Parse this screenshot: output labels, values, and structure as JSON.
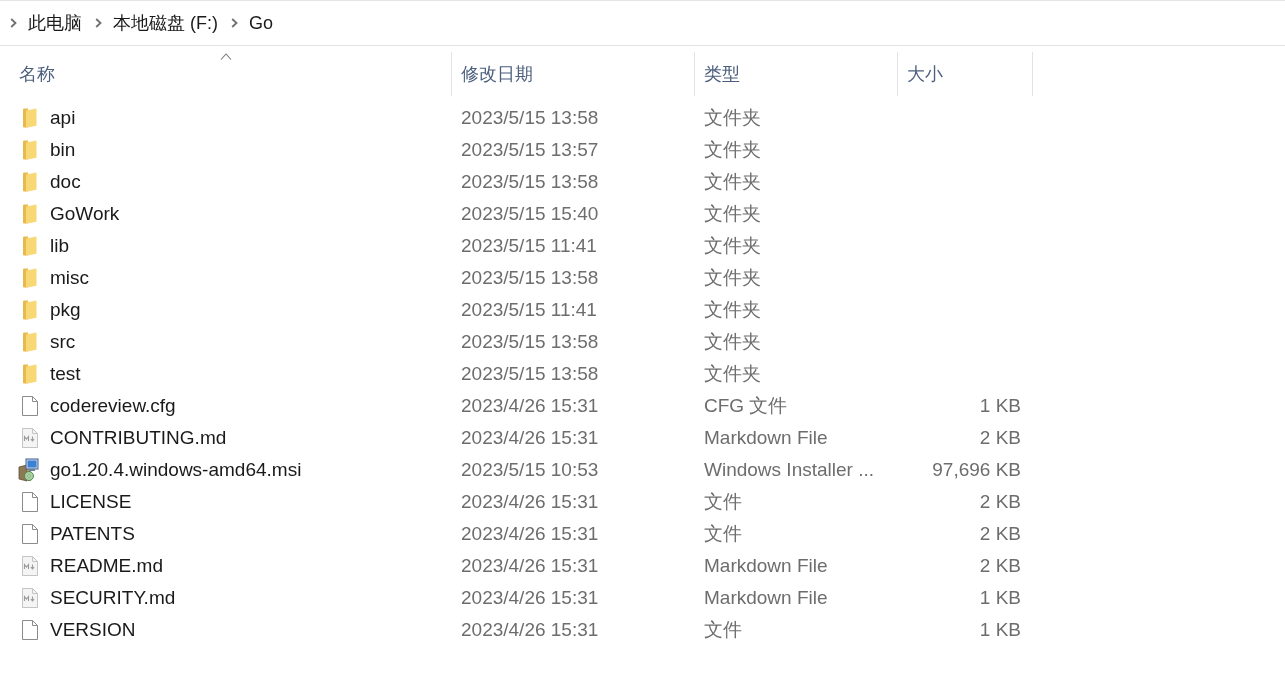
{
  "breadcrumb": [
    "此电脑",
    "本地磁盘 (F:)",
    "Go"
  ],
  "columns": [
    {
      "label": "名称",
      "sorted": true
    },
    {
      "label": "修改日期",
      "sorted": false
    },
    {
      "label": "类型",
      "sorted": false
    },
    {
      "label": "大小",
      "sorted": false
    }
  ],
  "files": [
    {
      "kind": "folder",
      "name": "api",
      "modified": "2023/5/15 13:58",
      "type": "文件夹"
    },
    {
      "kind": "folder",
      "name": "bin",
      "modified": "2023/5/15 13:57",
      "type": "文件夹"
    },
    {
      "kind": "folder",
      "name": "doc",
      "modified": "2023/5/15 13:58",
      "type": "文件夹"
    },
    {
      "kind": "folder",
      "name": "GoWork",
      "modified": "2023/5/15 15:40",
      "type": "文件夹"
    },
    {
      "kind": "folder",
      "name": "lib",
      "modified": "2023/5/15 11:41",
      "type": "文件夹"
    },
    {
      "kind": "folder",
      "name": "misc",
      "modified": "2023/5/15 13:58",
      "type": "文件夹"
    },
    {
      "kind": "folder",
      "name": "pkg",
      "modified": "2023/5/15 11:41",
      "type": "文件夹"
    },
    {
      "kind": "folder",
      "name": "src",
      "modified": "2023/5/15 13:58",
      "type": "文件夹"
    },
    {
      "kind": "folder",
      "name": "test",
      "modified": "2023/5/15 13:58",
      "type": "文件夹"
    },
    {
      "kind": "file",
      "name": "codereview.cfg",
      "modified": "2023/4/26 15:31",
      "type": "CFG 文件",
      "size": "1 KB"
    },
    {
      "kind": "markdown",
      "name": "CONTRIBUTING.md",
      "modified": "2023/4/26 15:31",
      "type": "Markdown File",
      "size": "2 KB"
    },
    {
      "kind": "installer",
      "name": "go1.20.4.windows-amd64.msi",
      "modified": "2023/5/15 10:53",
      "type": "Windows Installer ...",
      "size": "97,696 KB"
    },
    {
      "kind": "file",
      "name": "LICENSE",
      "modified": "2023/4/26 15:31",
      "type": "文件",
      "size": "2 KB"
    },
    {
      "kind": "file",
      "name": "PATENTS",
      "modified": "2023/4/26 15:31",
      "type": "文件",
      "size": "2 KB"
    },
    {
      "kind": "markdown",
      "name": "README.md",
      "modified": "2023/4/26 15:31",
      "type": "Markdown File",
      "size": "2 KB"
    },
    {
      "kind": "markdown",
      "name": "SECURITY.md",
      "modified": "2023/4/26 15:31",
      "type": "Markdown File",
      "size": "1 KB"
    },
    {
      "kind": "file",
      "name": "VERSION",
      "modified": "2023/4/26 15:31",
      "type": "文件",
      "size": "1 KB"
    }
  ]
}
